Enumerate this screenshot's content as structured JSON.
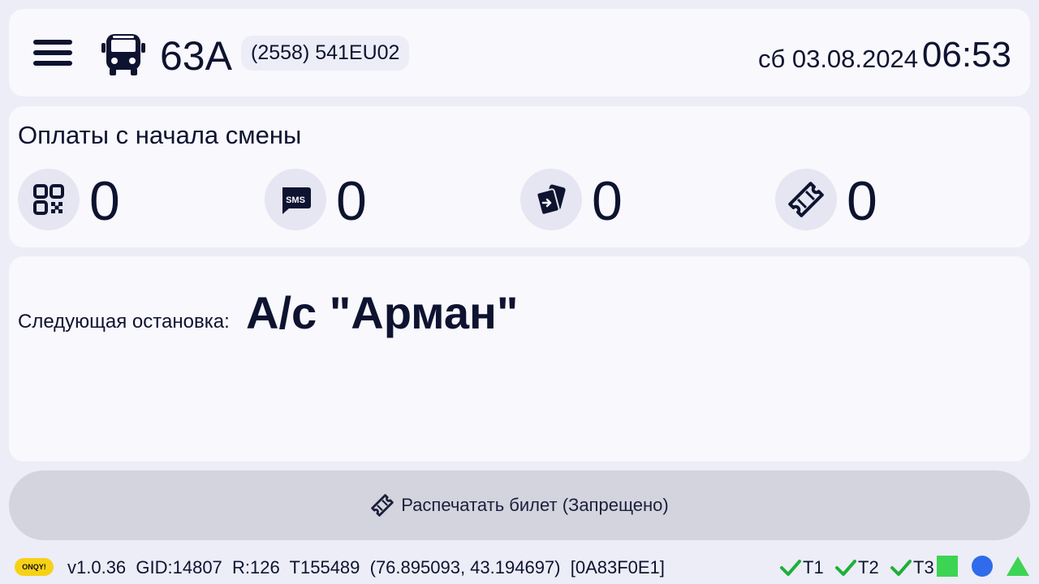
{
  "header": {
    "route_number": "63A",
    "vehicle_badge": "(2558) 541EU02",
    "date": "сб 03.08.2024",
    "time": "06:53"
  },
  "payments": {
    "title": "Оплаты с начала смены",
    "items": [
      {
        "icon": "qr-code-icon",
        "count": "0"
      },
      {
        "icon": "sms-icon",
        "count": "0"
      },
      {
        "icon": "card-icon",
        "count": "0"
      },
      {
        "icon": "ticket-icon",
        "count": "0"
      }
    ]
  },
  "next_stop": {
    "label": "Следующая остановка:",
    "name": "А/с \"Арман\""
  },
  "print_button": {
    "label": "Распечатать билет (Запрещено)"
  },
  "status_bar": {
    "logo_text": "ONQY!",
    "info": "v1.0.36  GID:14807  R:126  T155489  (76.895093, 43.194697)  [0A83F0E1]",
    "indicators": [
      "T1",
      "T2",
      "T3"
    ],
    "colors": {
      "check": "#1FAF3A",
      "square": "#3DD454",
      "circle": "#2F6BEA",
      "triangle": "#3DD454"
    }
  }
}
